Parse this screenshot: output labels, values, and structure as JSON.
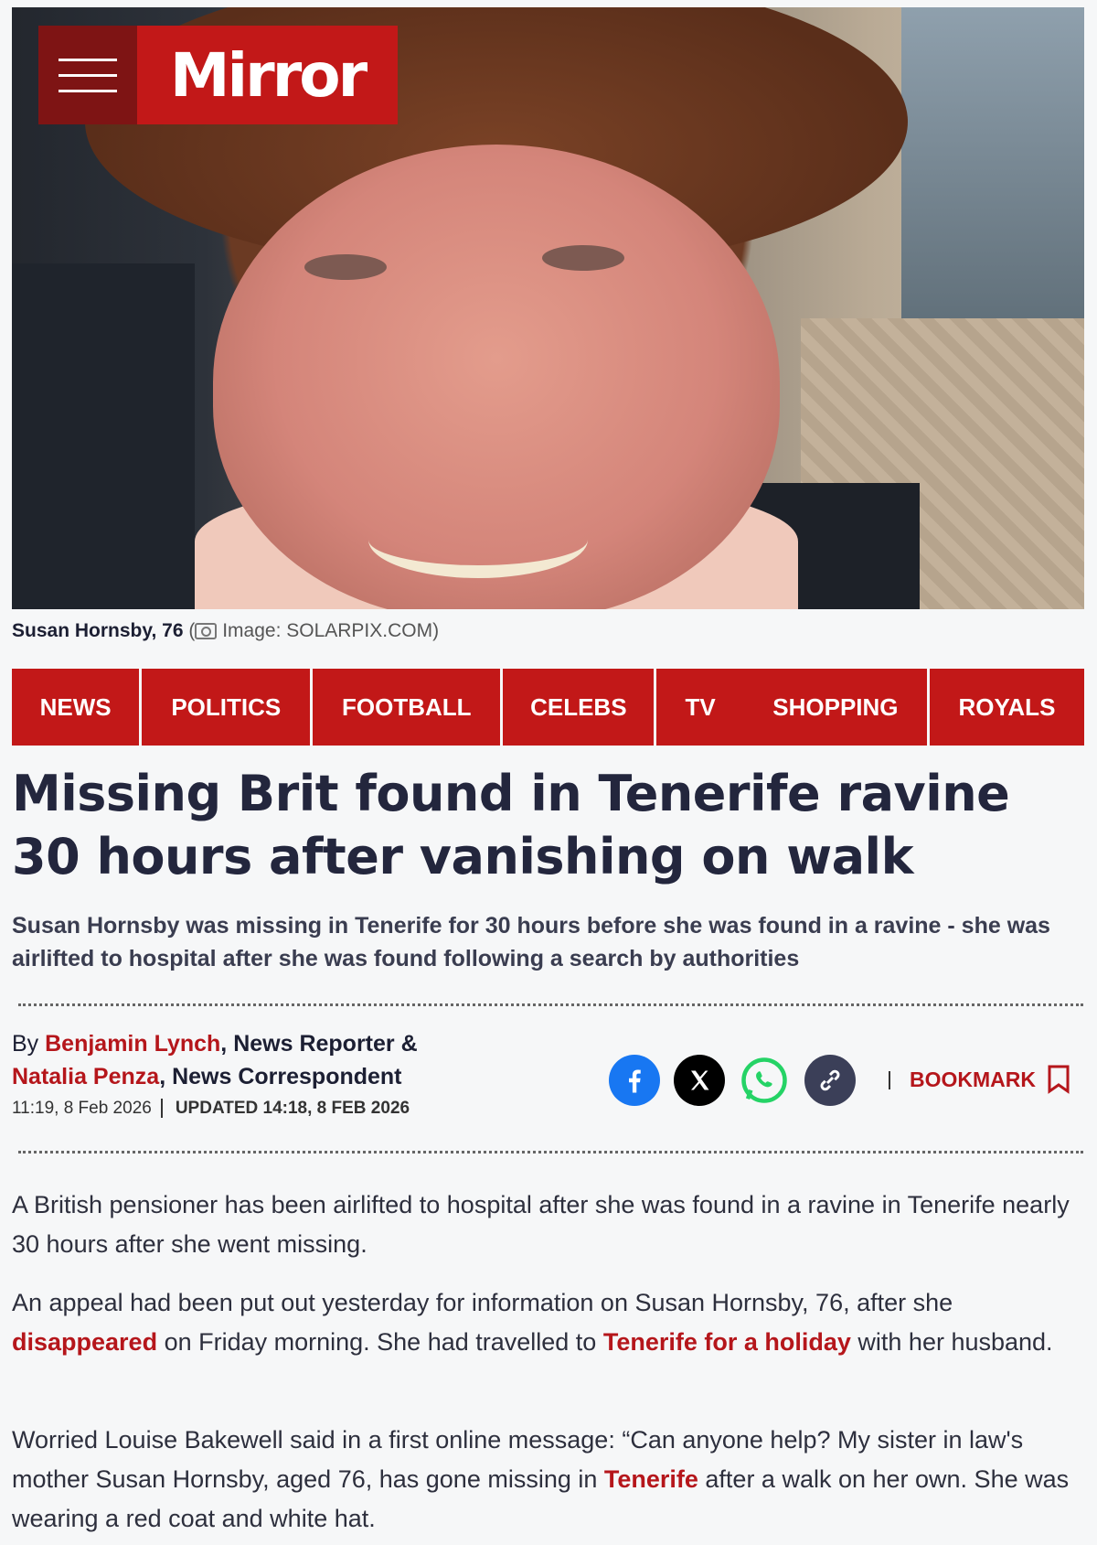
{
  "brand": {
    "logo_text": "Mirror",
    "menu_icon": "hamburger-menu-icon"
  },
  "hero": {
    "caption_name": "Susan Hornsby, 76",
    "caption_credit": "(",
    "caption_image_label": "Image: SOLARPIX.COM)"
  },
  "nav": {
    "items": [
      "NEWS",
      "POLITICS",
      "FOOTBALL",
      "CELEBS",
      "TV",
      "SHOPPING",
      "ROYALS"
    ]
  },
  "article": {
    "headline": "Missing Brit found in Tenerife ravine 30 hours after vanishing on walk",
    "standfirst": "Susan Hornsby was missing in Tenerife for 30 hours before she was found in a ravine - she was airlifted to hospital after she was found following a search by authorities",
    "byline": {
      "by": "By ",
      "author1": "Benjamin Lynch",
      "role1": ", News Reporter &",
      "author2": "Natalia Penza",
      "role2": ", News Correspondent"
    },
    "published": "11:19, 8 Feb 2026",
    "updated": "UPDATED 14:18, 8 FEB 2026",
    "share": {
      "facebook": "facebook-icon",
      "x": "x-icon",
      "whatsapp": "whatsapp-icon",
      "link": "link-icon"
    },
    "bookmark_label": "BOOKMARK",
    "paragraphs": {
      "p1": "A British pensioner has been airlifted to hospital after she was found in a ravine in Tenerife nearly 30 hours after she went missing.",
      "p2_a": "An appeal had been put out yesterday for information on Susan Hornsby, 76, after she ",
      "p2_link1": "disappeared",
      "p2_b": " on Friday morning. She had travelled to ",
      "p2_link2": "Tenerife for a holiday",
      "p2_c": " with her husband.",
      "p3_a": "Worried Louise Bakewell said in a first online message: “Can anyone help? My sister in law's mother Susan Hornsby, aged 76, has gone missing in ",
      "p3_link": "Tenerife",
      "p3_b": " after a walk on her own. She was wearing a red coat and white hat."
    }
  },
  "colors": {
    "brand_red": "#c21818",
    "brand_dark_red": "#7e1414",
    "link_red": "#b5161b",
    "facebook": "#1877f2",
    "whatsapp": "#25d366",
    "link_icon_bg": "#3b3f58",
    "headline": "#23263d"
  }
}
